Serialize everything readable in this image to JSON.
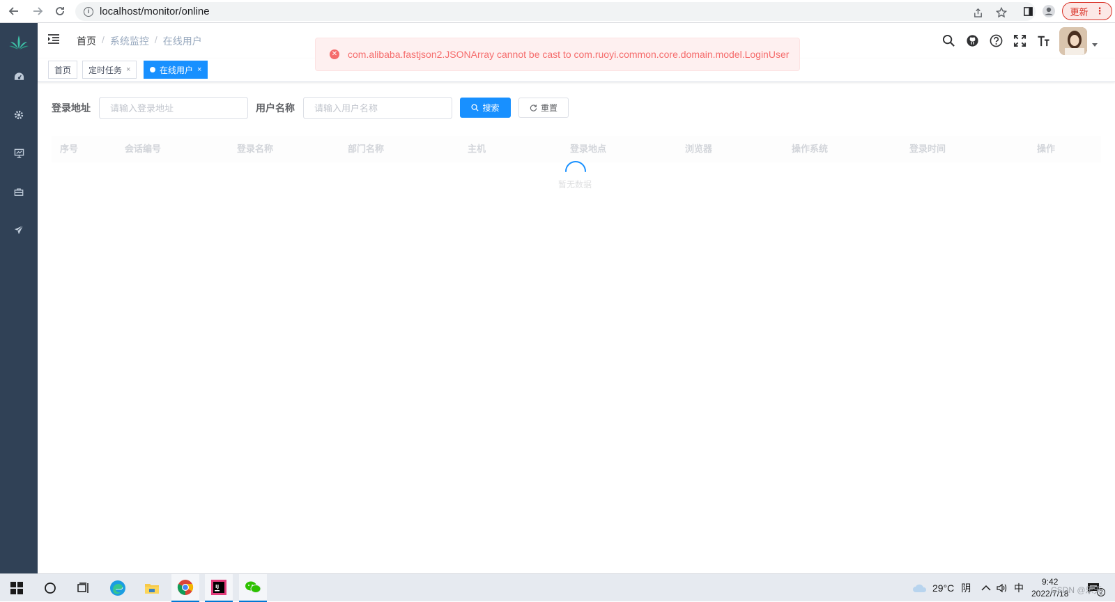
{
  "browser": {
    "url": "localhost/monitor/online",
    "update_label": "更新"
  },
  "header": {
    "breadcrumb": [
      "首页",
      "系统监控",
      "在线用户"
    ],
    "separator": "/"
  },
  "tags": [
    {
      "label": "首页",
      "active": false,
      "closable": false
    },
    {
      "label": "定时任务",
      "active": false,
      "closable": true
    },
    {
      "label": "在线用户",
      "active": true,
      "closable": true
    }
  ],
  "alert": {
    "message": "com.alibaba.fastjson2.JSONArray cannot be cast to com.ruoyi.common.core.domain.model.LoginUser"
  },
  "form": {
    "ipaddr_label": "登录地址",
    "ipaddr_placeholder": "请输入登录地址",
    "username_label": "用户名称",
    "username_placeholder": "请输入用户名称",
    "search_label": "搜索",
    "reset_label": "重置"
  },
  "table": {
    "columns": [
      "序号",
      "会话编号",
      "登录名称",
      "部门名称",
      "主机",
      "登录地点",
      "浏览器",
      "操作系统",
      "登录时间",
      "操作"
    ],
    "empty_text": "暂无数据"
  },
  "taskbar": {
    "weather": "29°C",
    "weather_desc": "阴",
    "ime": "中",
    "time": "9:42",
    "date": "2022/7/18",
    "watermark": "CSDN @乐天",
    "notification_count": "2"
  },
  "colors": {
    "sidebar": "#304156",
    "primary": "#1890ff",
    "error": "#f56c6c",
    "error_bg": "#fef0f0"
  }
}
